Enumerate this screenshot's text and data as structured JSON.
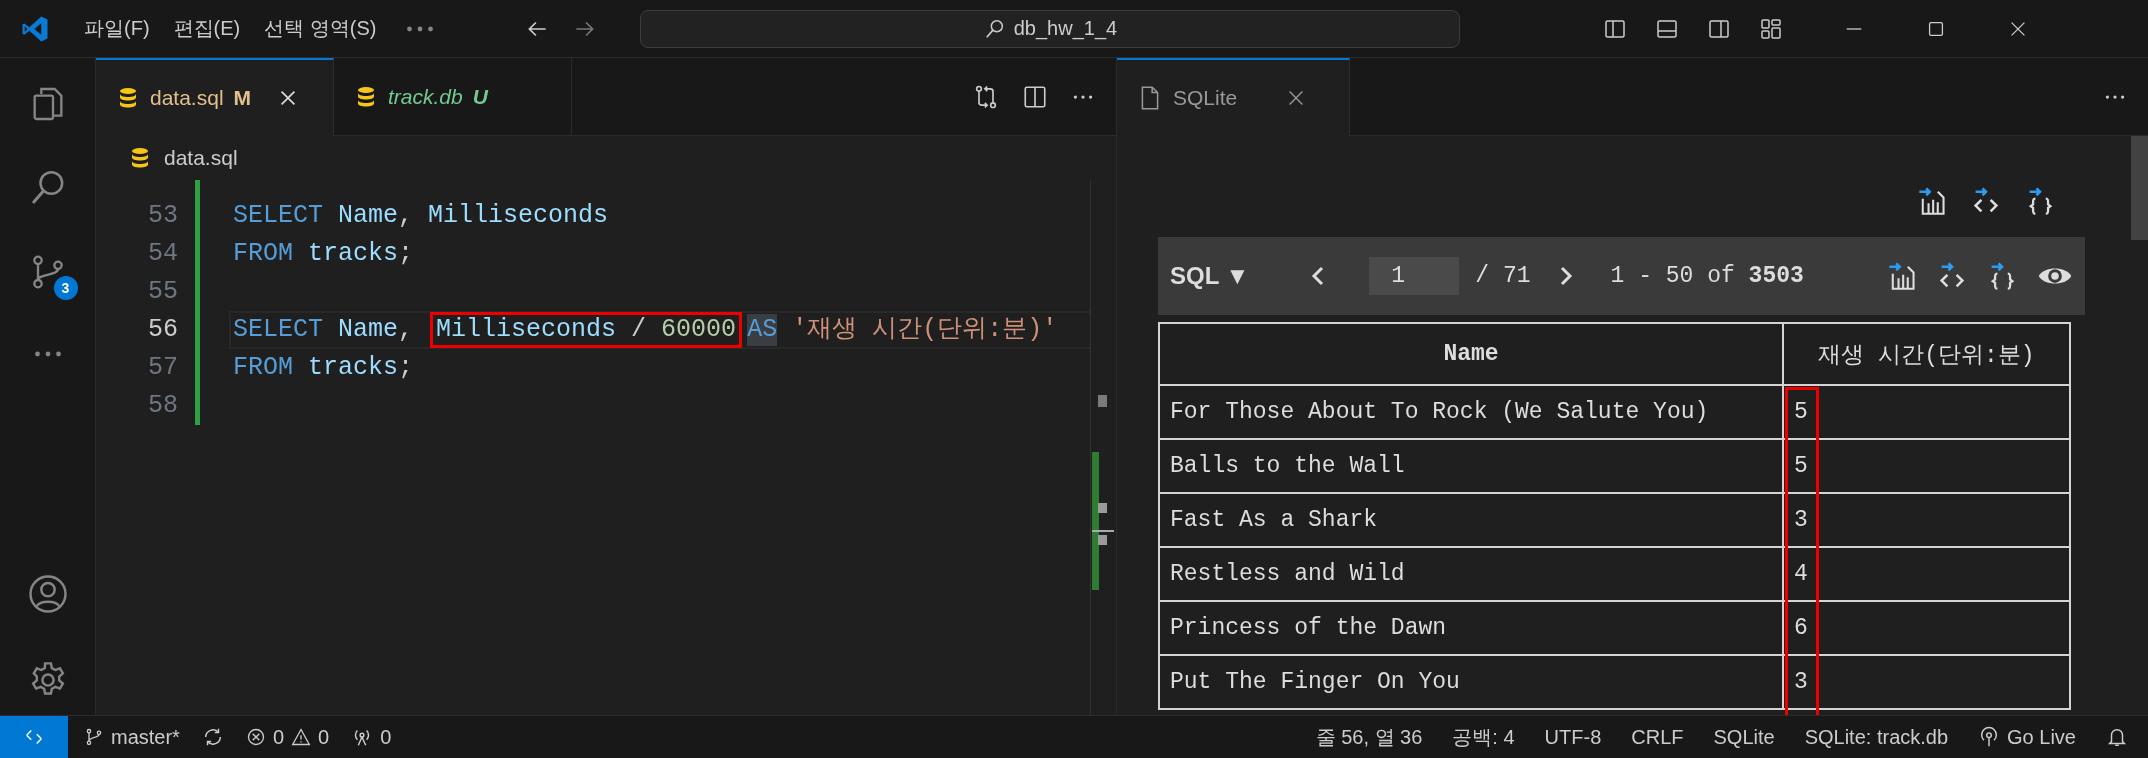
{
  "title_bar": {
    "menus": [
      "파일(F)",
      "편집(E)",
      "선택 영역(S)"
    ],
    "search": "db_hw_1_4"
  },
  "activity_bar": {
    "items": [
      {
        "kind": "explorer"
      },
      {
        "kind": "search"
      },
      {
        "kind": "source_control",
        "badge": "3"
      },
      {
        "kind": "more"
      }
    ],
    "bottom": [
      {
        "kind": "account"
      },
      {
        "kind": "settings"
      }
    ]
  },
  "editor": {
    "tabs": [
      {
        "label": "data.sql",
        "badge": "M",
        "color": "#e2c08d",
        "preview": false,
        "selected": true
      },
      {
        "label": "track.db",
        "badge": "U",
        "color": "#73c991",
        "preview": true,
        "selected": false
      }
    ],
    "breadcrumb": "data.sql",
    "lines": [
      {
        "number": "53",
        "current": false,
        "tokens": [
          {
            "kind": "keyword",
            "text": "SELECT "
          },
          {
            "kind": "identifier",
            "text": "Name"
          },
          {
            "kind": "plain",
            "text": ", "
          },
          {
            "kind": "identifier",
            "text": "Milliseconds"
          }
        ]
      },
      {
        "number": "54",
        "current": false,
        "tokens": [
          {
            "kind": "keyword",
            "text": "FROM "
          },
          {
            "kind": "identifier",
            "text": "tracks"
          },
          {
            "kind": "plain",
            "text": ";"
          }
        ]
      },
      {
        "number": "55",
        "current": false
      },
      {
        "number": "56",
        "current": true,
        "tokens": [
          {
            "kind": "keyword",
            "text": "SELECT "
          },
          {
            "kind": "identifier",
            "text": "Name"
          },
          {
            "kind": "plain",
            "text": ", "
          },
          {
            "kind": "identifier",
            "text": "Milliseconds",
            "boxed": true
          },
          {
            "kind": "plain",
            "text": " / ",
            "boxed": true
          },
          {
            "kind": "number",
            "text": "60000",
            "boxed": true
          },
          {
            "kind": "keyword",
            "text": "AS",
            "highlighted": true
          },
          {
            "kind": "string",
            "text": " '재생 시간(단위:분)'"
          }
        ]
      },
      {
        "number": "57",
        "current": false,
        "tokens": [
          {
            "kind": "keyword",
            "text": "FROM "
          },
          {
            "kind": "identifier",
            "text": "tracks"
          },
          {
            "kind": "plain",
            "text": ";"
          }
        ]
      },
      {
        "number": "58",
        "current": false
      }
    ]
  },
  "sqlite": {
    "tab": "SQLite",
    "mode": "SQL ▼",
    "page": "1",
    "pages": "/ 71",
    "range": "1 - 50 of **3503**",
    "table": {
      "columns": [
        {
          "label": "Name"
        },
        {
          "label": "재생 시간(단위:분)",
          "boxed": true
        }
      ],
      "rows": [
        [
          "For Those About To Rock (We Salute You)",
          "5"
        ],
        [
          "Balls to the Wall",
          "5"
        ],
        [
          "Fast As a Shark",
          "3"
        ],
        [
          "Restless and Wild",
          "4"
        ],
        [
          "Princess of the Dawn",
          "6"
        ],
        [
          "Put The Finger On You",
          "3"
        ]
      ]
    }
  },
  "status_bar": {
    "branch": "master*",
    "errors": "0",
    "warnings": "0",
    "ports": "0",
    "items": [
      "줄 56, 열 36",
      "공백: 4",
      "UTF-8",
      "CRLF",
      "SQLite",
      "SQLite: track.db"
    ],
    "live": "Go Live"
  }
}
